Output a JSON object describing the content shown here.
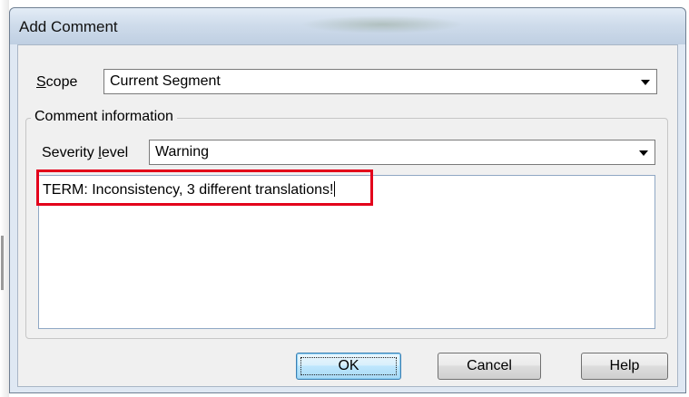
{
  "window": {
    "title": "Add Comment"
  },
  "scope": {
    "label": "Scope",
    "value": "Current Segment"
  },
  "comment_info": {
    "group_label": "Comment information",
    "severity_label": "Severity level",
    "severity_value": "Warning",
    "comment_text": "TERM: Inconsistency, 3 different translations!"
  },
  "buttons": {
    "ok": "OK",
    "cancel": "Cancel",
    "help": "Help"
  },
  "colors": {
    "highlight": "#e3001b",
    "dialog_background": "#f0f0f0",
    "titlebar": "#cfdceb"
  },
  "icons": [
    "chevron-down-icon"
  ]
}
